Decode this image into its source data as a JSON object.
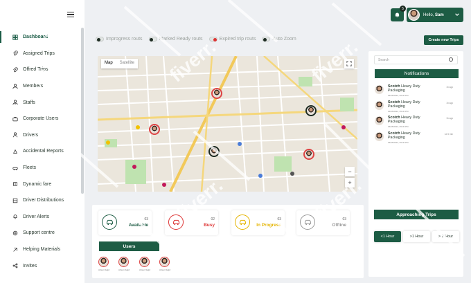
{
  "header": {
    "notification_count": "5",
    "greeting": "Hello,",
    "user_name": "Sam"
  },
  "sidebar": {
    "items": [
      {
        "label": "Dashboard",
        "icon": "dashboard-icon",
        "active": true
      },
      {
        "label": "Assigned Trips",
        "icon": "paperclip-icon"
      },
      {
        "label": "Offred Trips",
        "icon": "paperclip-icon"
      },
      {
        "label": "Members",
        "icon": "members-icon"
      },
      {
        "label": "Staffs",
        "icon": "staff-icon"
      },
      {
        "label": "Corporate Users",
        "icon": "briefcase-icon"
      },
      {
        "label": "Drivers",
        "icon": "driver-icon"
      },
      {
        "label": "Accidental Reports",
        "icon": "report-icon"
      },
      {
        "label": "Fleets",
        "icon": "fleet-icon"
      },
      {
        "label": "Dynamic fare",
        "icon": "fare-icon"
      },
      {
        "label": "Driver Distributions",
        "icon": "distribution-icon"
      },
      {
        "label": "Driver Alerts",
        "icon": "bell-icon"
      },
      {
        "label": "Support centre",
        "icon": "support-icon"
      },
      {
        "label": "Helping Materials",
        "icon": "materials-icon"
      },
      {
        "label": "Invites",
        "icon": "share-icon"
      }
    ]
  },
  "filters": [
    {
      "label": "Improgress routs",
      "color": "#1d2b22"
    },
    {
      "label": "Marked Ready routs",
      "color": "#1d2b22"
    },
    {
      "label": "Expired trip routs",
      "color": "#dd3333"
    },
    {
      "label": "Auto Zoom",
      "color": "#1d2b22"
    }
  ],
  "create_button": "Create new Trips",
  "map": {
    "tab_map": "Map",
    "tab_satellite": "Satellite",
    "zoom_in": "+",
    "zoom_out": "−"
  },
  "status_cards": [
    {
      "count": "03",
      "label": "Available",
      "color": "#1d5c44",
      "icon": "car-icon"
    },
    {
      "count": "02",
      "label": "Busy",
      "color": "#dd3333",
      "icon": "car-icon"
    },
    {
      "count": "03",
      "label": "In Progress",
      "color": "#e5b400",
      "icon": "car-icon"
    },
    {
      "count": "03",
      "label": "Offline",
      "color": "#9a9a9a",
      "icon": "car-icon"
    }
  ],
  "users": {
    "title": "Users",
    "names": [
      "Ahsan Sajid",
      "Ahsan Sajid",
      "Ahsan Sajid",
      "Ahsan Sajid"
    ]
  },
  "right_panel": {
    "search_placeholder": "Search",
    "notifications_title": "Notifications",
    "notifications": [
      {
        "name": "Scotch",
        "text": "Heavy Duty Packaging",
        "date": "06/05/2022, 05:30 PM",
        "time": "1h ago"
      },
      {
        "name": "Scotch",
        "text": "Heavy Duty Packaging",
        "date": "06/05/2022, 05:30 PM",
        "time": "1h ago"
      },
      {
        "name": "Scotch",
        "text": "Heavy Duty Packaging",
        "date": "06/05/2022, 05:30 PM",
        "time": "1h ago"
      },
      {
        "name": "Scotch",
        "text": "Heavy Duty Packaging",
        "date": "06/05/2022, 05:30 PM",
        "time": "1d 5 min"
      }
    ],
    "approaching_title": "Approaching Trips",
    "hour_buttons": [
      "<1 Hour",
      ">1 Hour",
      "> 2 Hour"
    ]
  },
  "watermark": "fiverr."
}
